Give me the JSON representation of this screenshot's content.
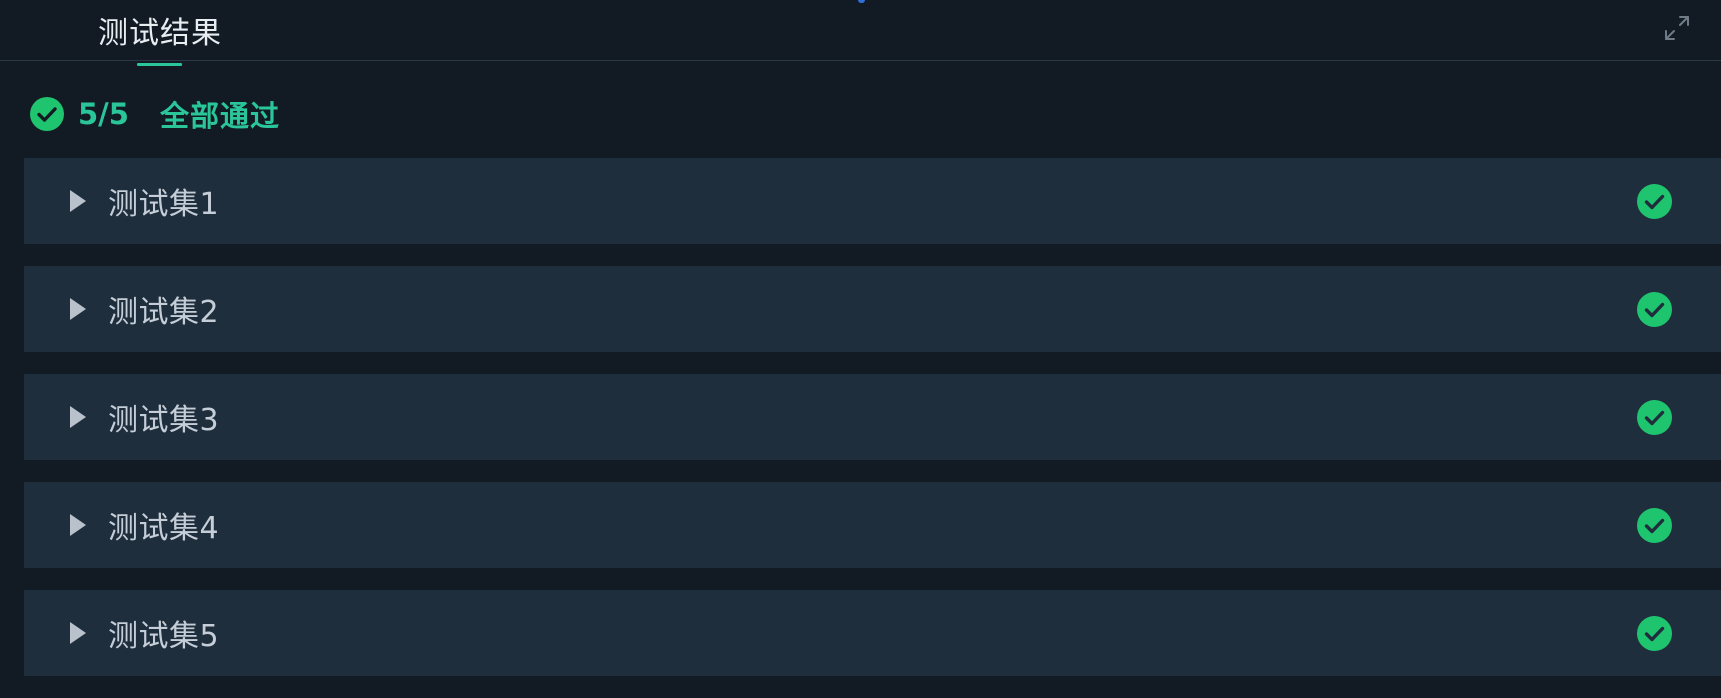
{
  "header": {
    "tab_label": "测试结果",
    "expand_icon": "expand-icon"
  },
  "summary": {
    "status_icon": "check-circle-icon",
    "count": "5/5",
    "text": "全部通过"
  },
  "suites": [
    {
      "label": "测试集1",
      "status": "passed",
      "status_icon": "check-circle-icon",
      "caret_icon": "caret-right-icon"
    },
    {
      "label": "测试集2",
      "status": "passed",
      "status_icon": "check-circle-icon",
      "caret_icon": "caret-right-icon"
    },
    {
      "label": "测试集3",
      "status": "passed",
      "status_icon": "check-circle-icon",
      "caret_icon": "caret-right-icon"
    },
    {
      "label": "测试集4",
      "status": "passed",
      "status_icon": "check-circle-icon",
      "caret_icon": "caret-right-icon"
    },
    {
      "label": "测试集5",
      "status": "passed",
      "status_icon": "check-circle-icon",
      "caret_icon": "caret-right-icon"
    }
  ],
  "colors": {
    "background": "#121b24",
    "suite_background": "#1f2e3c",
    "accent_green": "#2bc59a",
    "check_green": "#1fc46e",
    "text_primary": "#e8edf2",
    "text_secondary": "#c5ced8"
  }
}
